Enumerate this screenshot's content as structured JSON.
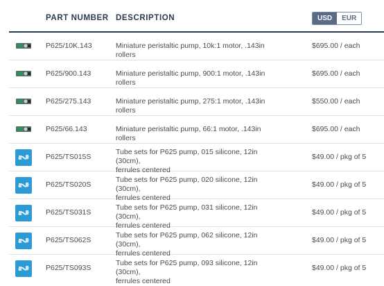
{
  "header": {
    "part_number": "PART NUMBER",
    "description": "DESCRIPTION",
    "currency_options": [
      "USD",
      "EUR"
    ],
    "currency_selected": "USD"
  },
  "rows": [
    {
      "kind": "pump",
      "part": "P625/10K.143",
      "desc": "Miniature peristaltic pump, 10k:1 motor, .143in rollers",
      "price": "$695.00 / each"
    },
    {
      "kind": "pump",
      "part": "P625/900.143",
      "desc": "Miniature peristaltic pump, 900:1 motor, .143in rollers",
      "price": "$695.00 / each"
    },
    {
      "kind": "pump",
      "part": "P625/275.143",
      "desc": "Miniature peristaltic pump, 275:1 motor, .143in rollers",
      "price": "$550.00 / each"
    },
    {
      "kind": "pump",
      "part": "P625/66.143",
      "desc": "Miniature peristaltic pump, 66:1 motor, .143in rollers",
      "price": "$695.00 / each"
    },
    {
      "kind": "tube",
      "part": "P625/TS015S",
      "desc1": "Tube sets for P625 pump, 015 silicone, 12in (30cm),",
      "desc2": "ferrules centered",
      "price": "$49.00 / pkg of 5"
    },
    {
      "kind": "tube",
      "part": "P625/TS020S",
      "desc1": "Tube sets for P625 pump, 020 silicone, 12in (30cm),",
      "desc2": "ferrules centered",
      "price": "$49.00 / pkg of 5"
    },
    {
      "kind": "tube",
      "part": "P625/TS031S",
      "desc1": "Tube sets for P625 pump, 031 silicone, 12in (30cm),",
      "desc2": "ferrules centered",
      "price": "$49.00 / pkg of 5"
    },
    {
      "kind": "tube",
      "part": "P625/TS062S",
      "desc1": "Tube sets for P625 pump, 062 silicone, 12in (30cm),",
      "desc2": "ferrules centered",
      "price": "$49.00 / pkg of 5"
    },
    {
      "kind": "tube",
      "part": "P625/TS093S",
      "desc1": "Tube sets for P625 pump, 093 silicone, 12in (30cm),",
      "desc2": "ferrules centered",
      "price": "$49.00 / pkg of 5"
    }
  ],
  "colors": {
    "header_text": "#2b3a4f",
    "toggle_active": "#5a6b85",
    "tube_thumb": "#2d9ad6"
  }
}
